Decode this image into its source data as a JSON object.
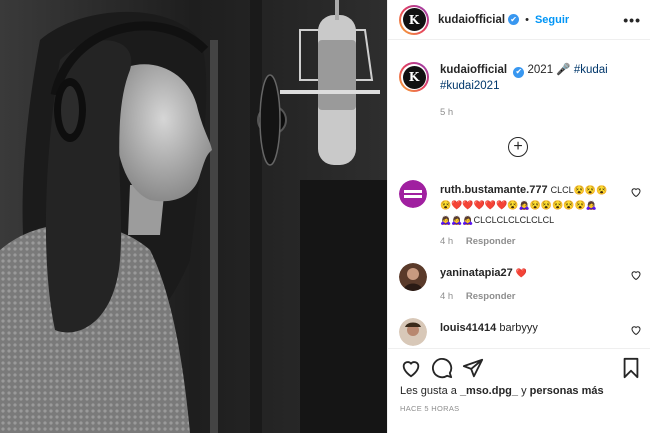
{
  "header": {
    "username": "kudaiofficial",
    "separator": "•",
    "follow_label": "Seguir",
    "more_label": "•••",
    "logo_letter": "K"
  },
  "caption": {
    "username": "kudaiofficial",
    "text": "2021 🎤",
    "tags": [
      "#kudai",
      "#kudai2021"
    ],
    "time": "5 h"
  },
  "load_more_label": "+",
  "comments": [
    {
      "username": "ruth.bustamante.777",
      "text_line1": "CLCL😵😵😵",
      "text_line2": "😵❤️❤️❤️❤️❤️😵🙇‍♀️😵😵😵😵😵🙇‍♀️",
      "text_line3": "🙇‍♀️🙇‍♀️🙇‍♀️CLCLCLCLCLCLCL",
      "time": "4 h",
      "reply_label": "Responder"
    },
    {
      "username": "yaninatapia27",
      "text_line1": "❤️",
      "time": "4 h",
      "reply_label": "Responder"
    },
    {
      "username": "louis41414",
      "text_line1": "barbyyy"
    }
  ],
  "likes": {
    "prefix": "Les gusta a",
    "user": "_mso.dpg_",
    "connector": "y",
    "suffix": "personas más"
  },
  "posted_ago": "HACE 5 HORAS",
  "colors": {
    "link_blue": "#0095f6",
    "tag_blue": "#00376b",
    "muted": "#8e8e8e",
    "text": "#262626",
    "verified": "#3897f0"
  }
}
